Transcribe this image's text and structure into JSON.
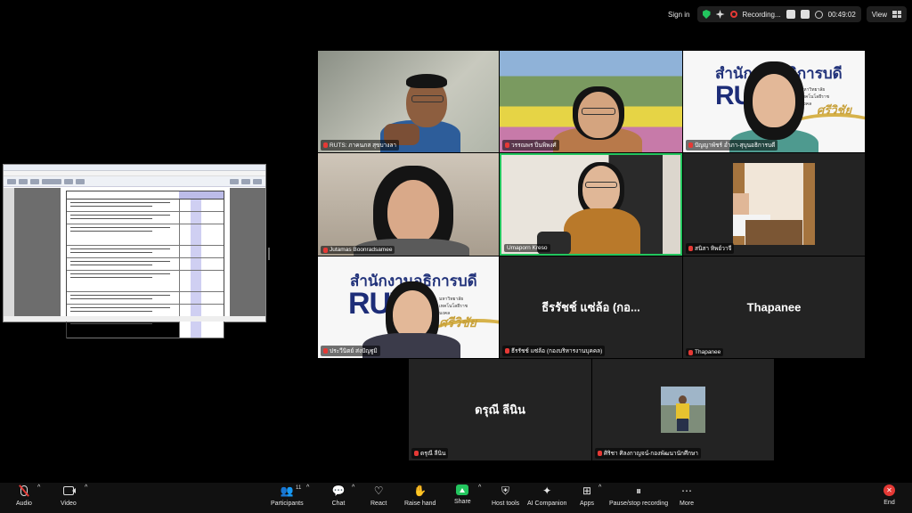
{
  "topbar": {
    "sign_in": "Sign in",
    "recording": "Recording...",
    "timer": "00:49:02",
    "view": "View"
  },
  "participants": [
    {
      "name": "RUTS: ภาคนภส สุขบางลา"
    },
    {
      "name": "วรรณพร ปิ่นพิพงศ์"
    },
    {
      "name": "ปัญญาพัชร์ อ่ำภา-สุบุนอธิการบดี"
    },
    {
      "name": "Jutamas Boonradsamee"
    },
    {
      "name": "Umaporn Kreso"
    },
    {
      "name": "สนิสา ทิพย์วาจี"
    },
    {
      "name": "ประวีนิตย์ ส่งปัญฐูมิ"
    },
    {
      "name": "ธีรรัชช์ แซ่ล้อ (กองบริหารงานบุคคล)",
      "display": "ธีรรัชช์ แซ่ล้อ (กอ..."
    },
    {
      "name": "Thapanee",
      "display": "Thapanee"
    },
    {
      "name": "ดรุณี ลีนิน",
      "display": "ดรุณี ลีนิน"
    },
    {
      "name": "ศิริชา ศิลงกาญจน์-กองพัฒนานักศึกษา"
    }
  ],
  "slide": {
    "title": "สำนักงานอธิการบดี",
    "logo": "RUTS",
    "university": "มหาวิทยาลัยเทคโนโลยีราชมงคล",
    "campus": "ศรีวิชัย"
  },
  "toolbar": {
    "audio": "Audio",
    "video": "Video",
    "participants": "Participants",
    "participants_count": "11",
    "chat": "Chat",
    "react": "React",
    "raise_hand": "Raise hand",
    "share": "Share",
    "host_tools": "Host tools",
    "ai_companion": "AI Companion",
    "apps": "Apps",
    "pause_stop_recording": "Pause/stop recording",
    "more": "More",
    "end": "End"
  },
  "colors": {
    "active_speaker": "#23c55e",
    "muted": "#e53935",
    "tile_bg": "#232323",
    "logo_blue": "#1d2d78",
    "logo_gold": "#c8a13a"
  }
}
